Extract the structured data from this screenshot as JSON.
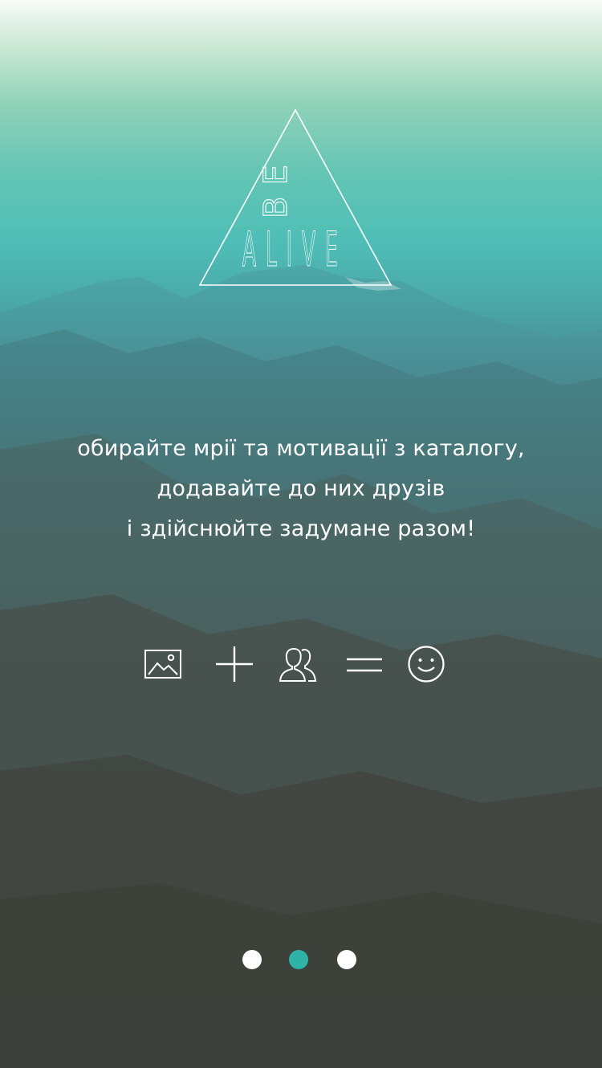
{
  "logo": {
    "word_top": "BE",
    "word_bottom": "ALIVE"
  },
  "tagline": {
    "line1": "обирайте мрії та мотивації з каталогу,",
    "line2": "додавайте до них друзів",
    "line3": "і здійснюйте задумане разом!"
  },
  "formula": {
    "icons": [
      "image-icon",
      "plus-icon",
      "people-icon",
      "equals-icon",
      "smiley-icon"
    ]
  },
  "pager": {
    "total": 3,
    "active_index": 1,
    "active_color": "#2fb3a8",
    "inactive_color": "#ffffff"
  },
  "colors": {
    "accent": "#2fb3a8",
    "text": "#ffffff"
  }
}
